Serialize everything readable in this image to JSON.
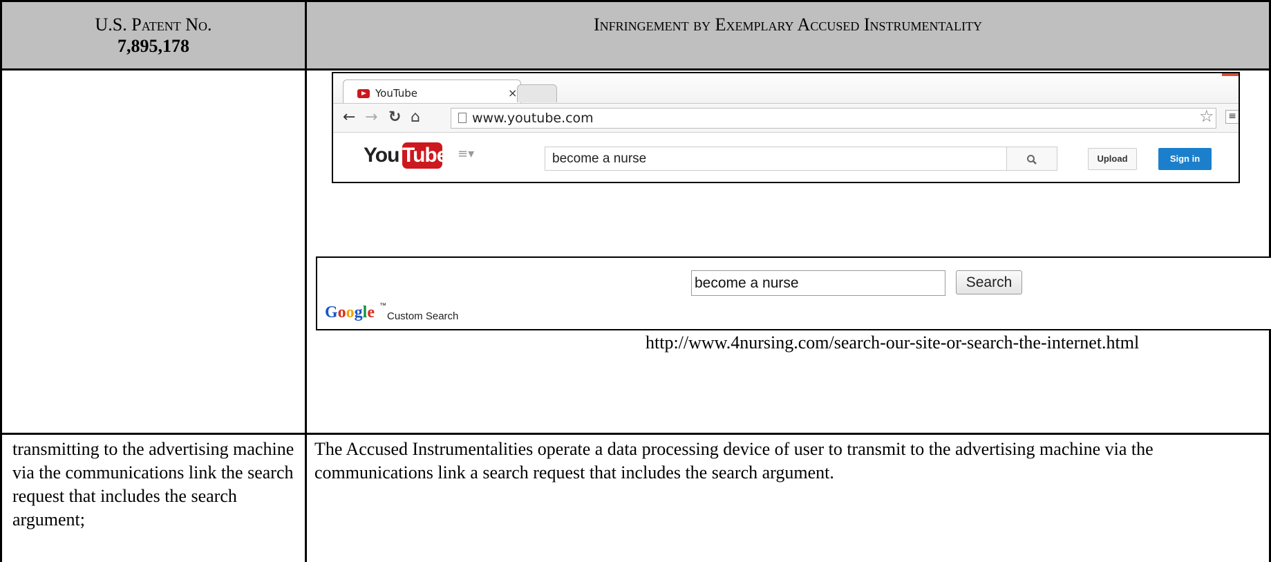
{
  "table": {
    "header_left_line1": "U.S. Patent No.",
    "header_left_line2": "7,895,178",
    "header_right": "Infringement by Exemplary Accused Instrumentality"
  },
  "browser": {
    "tab_title": "YouTube",
    "tab_close": "×",
    "url": "www.youtube.com",
    "youtube": {
      "logo_you": "You",
      "logo_tube": "Tube",
      "search_value": "become a nurse",
      "upload_label": "Upload",
      "signin_label": "Sign in"
    }
  },
  "google_custom_search": {
    "search_value": "become a nurse",
    "search_button": "Search",
    "logo_text": "Google",
    "tm": "™",
    "custom_search_label": "Custom Search"
  },
  "url_caption": "http://www.4nursing.com/search-our-site-or-search-the-internet.html",
  "row2": {
    "claim_text": "transmitting to the advertising machine via the communications link the search request that includes the search argument;",
    "infringement_text": "The Accused Instrumentalities operate a data processing device of user to transmit to the advertising machine via the communications link a search request that includes the search argument."
  },
  "icons": [
    "back-arrow-icon",
    "forward-arrow-icon",
    "reload-icon",
    "home-icon",
    "page-icon",
    "star-icon",
    "menu-icon",
    "search-icon",
    "youtube-favicon",
    "guide-icon"
  ]
}
